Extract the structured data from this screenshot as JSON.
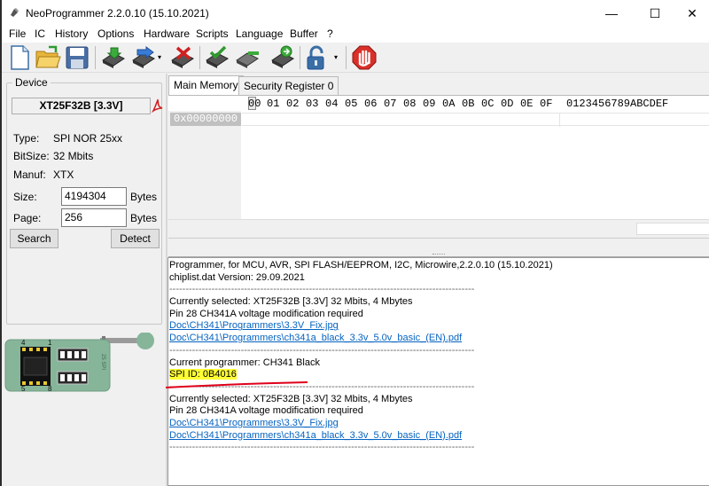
{
  "window": {
    "title": "NeoProgrammer 2.2.0.10 (15.10.2021)",
    "minimize_glyph": "—",
    "maximize_glyph": "☐",
    "close_glyph": "✕"
  },
  "menu": [
    "File",
    "IC",
    "History",
    "Options",
    "Hardware",
    "Scripts",
    "Language",
    "Buffer",
    "?"
  ],
  "toolbar": {
    "icons": [
      "new-file-icon",
      "open-folder-icon",
      "save-icon",
      "read-chip-icon",
      "write-chip-icon",
      "erase-chip-icon",
      "verify-chip-icon",
      "blank-check-icon",
      "auto-icon",
      "lock-icon",
      "stop-icon"
    ],
    "dropdown_glyph": "▾"
  },
  "device": {
    "group_label": "Device",
    "name": "XT25F32B [3.3V]",
    "type_label": "Type:",
    "type_value": "SPI NOR 25xx",
    "bitsize_label": "BitSize:",
    "bitsize_value": "32 Mbits",
    "manuf_label": "Manuf:",
    "manuf_value": "XTX",
    "size_label": "Size:",
    "size_value": "4194304",
    "size_unit": "Bytes",
    "page_label": "Page:",
    "page_value": "256",
    "page_unit": "Bytes",
    "search_button": "Search",
    "detect_button": "Detect"
  },
  "board": {
    "pin_top_left": "4",
    "pin_top_right": "1",
    "pin_bottom_left": "5",
    "pin_bottom_right": "8",
    "chip_label": "25 SPI"
  },
  "tabs": [
    "Main Memory",
    "Security Register 0"
  ],
  "hex": {
    "columns": [
      "00",
      "01",
      "02",
      "03",
      "04",
      "05",
      "06",
      "07",
      "08",
      "09",
      "0A",
      "0B",
      "0C",
      "0D",
      "0E",
      "0F"
    ],
    "ascii_header": "0123456789ABCDEF",
    "addresses": [
      "0x00000000"
    ]
  },
  "log": [
    {
      "text": "Programmer, for MCU, AVR, SPI FLASH/EEPROM, I2C, Microwire,2.2.0.10 (15.10.2021)",
      "kind": "text"
    },
    {
      "text": "chiplist.dat Version: 29.09.2021",
      "kind": "text"
    },
    {
      "text": "----------------------------------------------------------------------------------------------",
      "kind": "dash"
    },
    {
      "text": "Currently selected:  XT25F32B [3.3V] 32 Mbits, 4 Mbytes",
      "kind": "text"
    },
    {
      "text": "Pin 28 CH341A voltage modification required",
      "kind": "text"
    },
    {
      "text": "Doc\\CH341\\Programmers\\3.3V_Fix.jpg",
      "kind": "link"
    },
    {
      "text": "Doc\\CH341\\Programmers\\ch341a_black_3.3v_5.0v_basic_(EN).pdf",
      "kind": "link"
    },
    {
      "text": "----------------------------------------------------------------------------------------------",
      "kind": "dash"
    },
    {
      "text": "Current programmer: CH341 Black",
      "kind": "text"
    },
    {
      "text": "SPI ID: 0B4016",
      "kind": "highlight"
    },
    {
      "text": "----------------------------------------------------------------------------------------------",
      "kind": "dash"
    },
    {
      "text": "Currently selected:  XT25F32B [3.3V] 32 Mbits, 4 Mbytes",
      "kind": "text"
    },
    {
      "text": "Pin 28 CH341A voltage modification required",
      "kind": "text"
    },
    {
      "text": "Doc\\CH341\\Programmers\\3.3V_Fix.jpg",
      "kind": "link"
    },
    {
      "text": "Doc\\CH341\\Programmers\\ch341a_black_3.3v_5.0v_basic_(EN).pdf",
      "kind": "link"
    },
    {
      "text": "----------------------------------------------------------------------------------------------",
      "kind": "dash"
    }
  ],
  "colors": {
    "link": "#0563c1",
    "highlight": "#ffff33",
    "annotation_underline": "#e0001b",
    "board_green": "#86b59a",
    "stop_red": "#d9302a"
  }
}
